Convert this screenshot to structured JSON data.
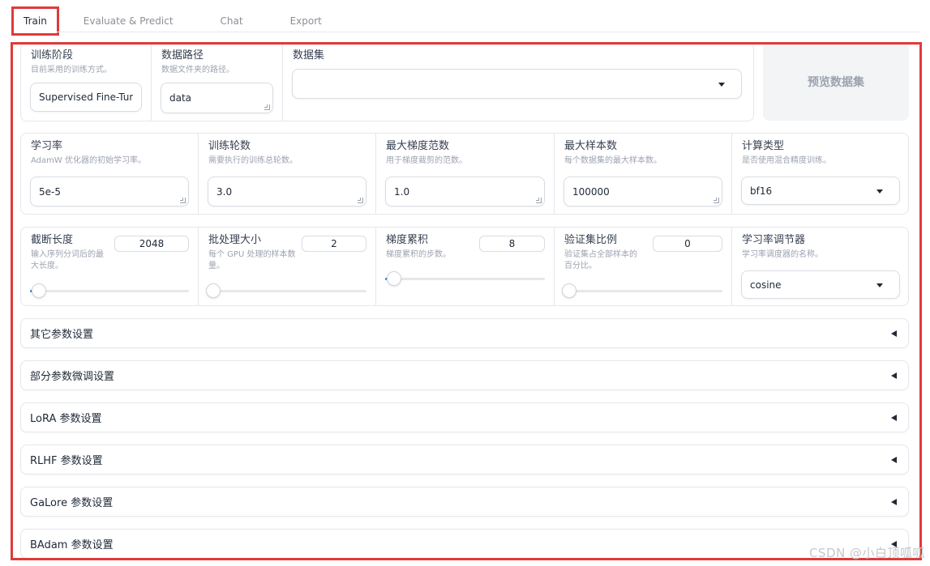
{
  "tabs": [
    {
      "label": "Train",
      "active": true
    },
    {
      "label": "Evaluate & Predict",
      "active": false
    },
    {
      "label": "Chat",
      "active": false
    },
    {
      "label": "Export",
      "active": false
    }
  ],
  "row1": {
    "stage": {
      "label": "训练阶段",
      "info": "目前采用的训练方式。",
      "value": "Supervised Fine-Tun"
    },
    "dataset_dir": {
      "label": "数据路径",
      "info": "数据文件夹的路径。",
      "value": "data"
    },
    "dataset": {
      "label": "数据集",
      "value": ""
    },
    "preview_button": "预览数据集"
  },
  "row2": {
    "learning_rate": {
      "label": "学习率",
      "info": "AdamW 优化器的初始学习率。",
      "value": "5e-5"
    },
    "num_epochs": {
      "label": "训练轮数",
      "info": "需要执行的训练总轮数。",
      "value": "3.0"
    },
    "max_grad_norm": {
      "label": "最大梯度范数",
      "info": "用于梯度裁剪的范数。",
      "value": "1.0"
    },
    "max_samples": {
      "label": "最大样本数",
      "info": "每个数据集的最大样本数。",
      "value": "100000"
    },
    "compute_type": {
      "label": "计算类型",
      "info": "是否使用混合精度训练。",
      "value": "bf16"
    }
  },
  "row3": {
    "cutoff_len": {
      "label": "截断长度",
      "info_line1": "输入序列分词后的最",
      "info_line2": "大长度。",
      "value": "2048",
      "level": 0.02
    },
    "batch_size": {
      "label": "批处理大小",
      "info_line1": "每个 GPU 处理的样本数",
      "info_line2": "量。",
      "value": "2",
      "level": 0.0
    },
    "grad_accum": {
      "label": "梯度累积",
      "info_line1": "梯度累积的步数。",
      "info_line2": "",
      "value": "8",
      "level": 0.02
    },
    "val_size": {
      "label": "验证集比例",
      "info_line1": "验证集占全部样本的",
      "info_line2": "百分比。",
      "value": "0",
      "level": 0.0
    },
    "lr_scheduler": {
      "label": "学习率调节器",
      "info": "学习率调度器的名称。",
      "value": "cosine"
    }
  },
  "accordions": [
    {
      "title": "其它参数设置"
    },
    {
      "title": "部分参数微调设置"
    },
    {
      "title": "LoRA 参数设置"
    },
    {
      "title": "RLHF 参数设置"
    },
    {
      "title": "GaLore 参数设置"
    },
    {
      "title": "BAdam 参数设置"
    }
  ],
  "watermark": "CSDN @小白顶呱呱",
  "colors": {
    "accent": "#3b82f6",
    "highlight": "#e03a3a",
    "preview_bg": "#f3f4f6"
  }
}
